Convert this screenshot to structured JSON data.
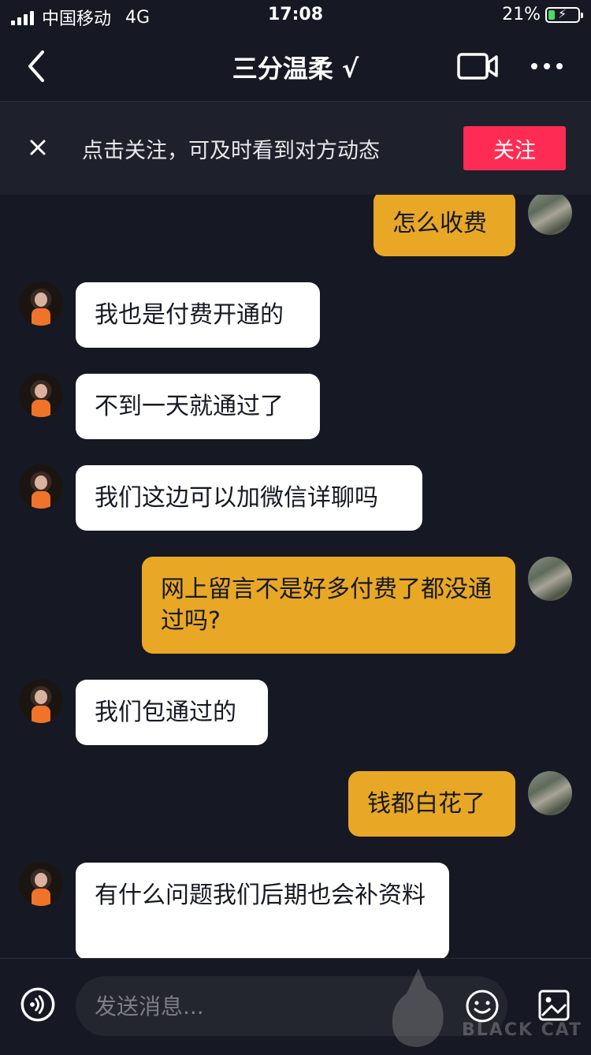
{
  "status_bar": {
    "carrier": "中国移动",
    "network": "4G",
    "time": "17:08",
    "battery": "21%",
    "battery_level": 0.21
  },
  "header": {
    "title": "三分温柔 √",
    "back_icon": "chevron-left-icon",
    "video_icon": "video-call-icon",
    "more_icon": "more-icon"
  },
  "follow_banner": {
    "text": "点击关注，可及时看到对方动态",
    "button_label": "关注"
  },
  "messages": [
    {
      "from": "me",
      "text": "怎么收费"
    },
    {
      "from": "other",
      "text": "我也是付费开通的"
    },
    {
      "from": "other",
      "text": "不到一天就通过了"
    },
    {
      "from": "other",
      "text": "我们这边可以加微信详聊吗"
    },
    {
      "from": "me",
      "text": "网上留言不是好多付费了都没通过吗?"
    },
    {
      "from": "other",
      "text": "我们包通过的"
    },
    {
      "from": "me",
      "text": "钱都白花了"
    },
    {
      "from": "other",
      "text": "有什么问题我们后期也会补资料"
    }
  ],
  "input_bar": {
    "placeholder": "发送消息...",
    "voice_icon": "voice-icon",
    "emoji_icon": "emoji-icon",
    "image_icon": "image-icon"
  },
  "watermark": {
    "text": "BLACK CAT"
  },
  "colors": {
    "background": "#161823",
    "accent": "#fe2c55",
    "my_bubble": "#e8a825",
    "their_bubble": "#ffffff"
  }
}
